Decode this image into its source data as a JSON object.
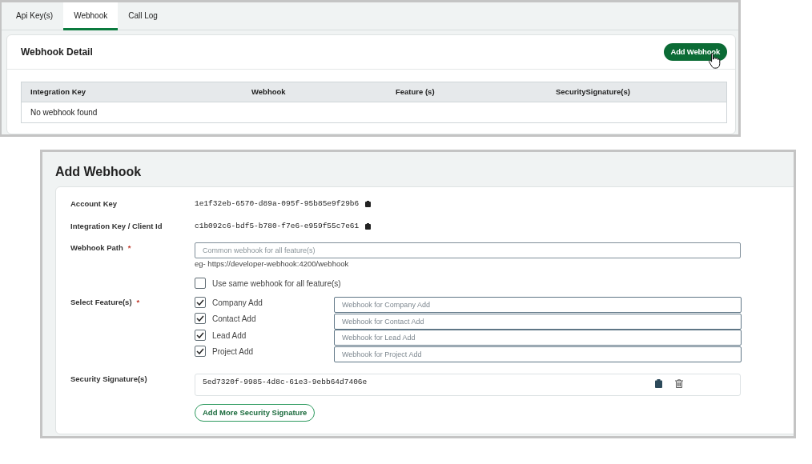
{
  "tabs": [
    {
      "label": "Api Key(s)",
      "selected": false
    },
    {
      "label": "Webhook",
      "selected": true
    },
    {
      "label": "Call Log",
      "selected": false
    }
  ],
  "webhook_detail": {
    "title": "Webhook Detail",
    "add_button": "Add Webhook",
    "table": {
      "columns": [
        "Integration Key",
        "Webhook",
        "Feature (s)",
        "SecuritySignature(s)"
      ],
      "empty_message": "No webhook found"
    }
  },
  "add_webhook": {
    "title": "Add Webhook",
    "account_key": {
      "label": "Account Key",
      "value": "1e1f32eb-6570-d89a-095f-95b85e9f29b6"
    },
    "integration_key": {
      "label": "Integration Key / Client Id",
      "value": "c1b092c6-bdf5-b780-f7e6-e959f55c7e61"
    },
    "webhook_path": {
      "label": "Webhook Path",
      "required_mark": "*",
      "placeholder": "Common webhook for all feature(s)",
      "hint": "eg- https://developer-webhook:4200/webhook"
    },
    "same_webhook": {
      "label": "Use same webhook for all feature(s)",
      "checked": false
    },
    "features": {
      "label": "Select Feature(s)",
      "required_mark": "*",
      "items": [
        {
          "label": "Company Add",
          "checked": true,
          "placeholder": "Webhook for Company Add"
        },
        {
          "label": "Contact Add",
          "checked": true,
          "placeholder": "Webhook for Contact Add"
        },
        {
          "label": "Lead Add",
          "checked": true,
          "placeholder": "Webhook for Lead Add"
        },
        {
          "label": "Project Add",
          "checked": true,
          "placeholder": "Webhook for Project Add"
        }
      ]
    },
    "security": {
      "label": "Security Signature(s)",
      "signatures": [
        "5ed7320f-9985-4d8c-61e3-9ebb64d7406e"
      ],
      "add_button": "Add More Security Signature"
    }
  }
}
